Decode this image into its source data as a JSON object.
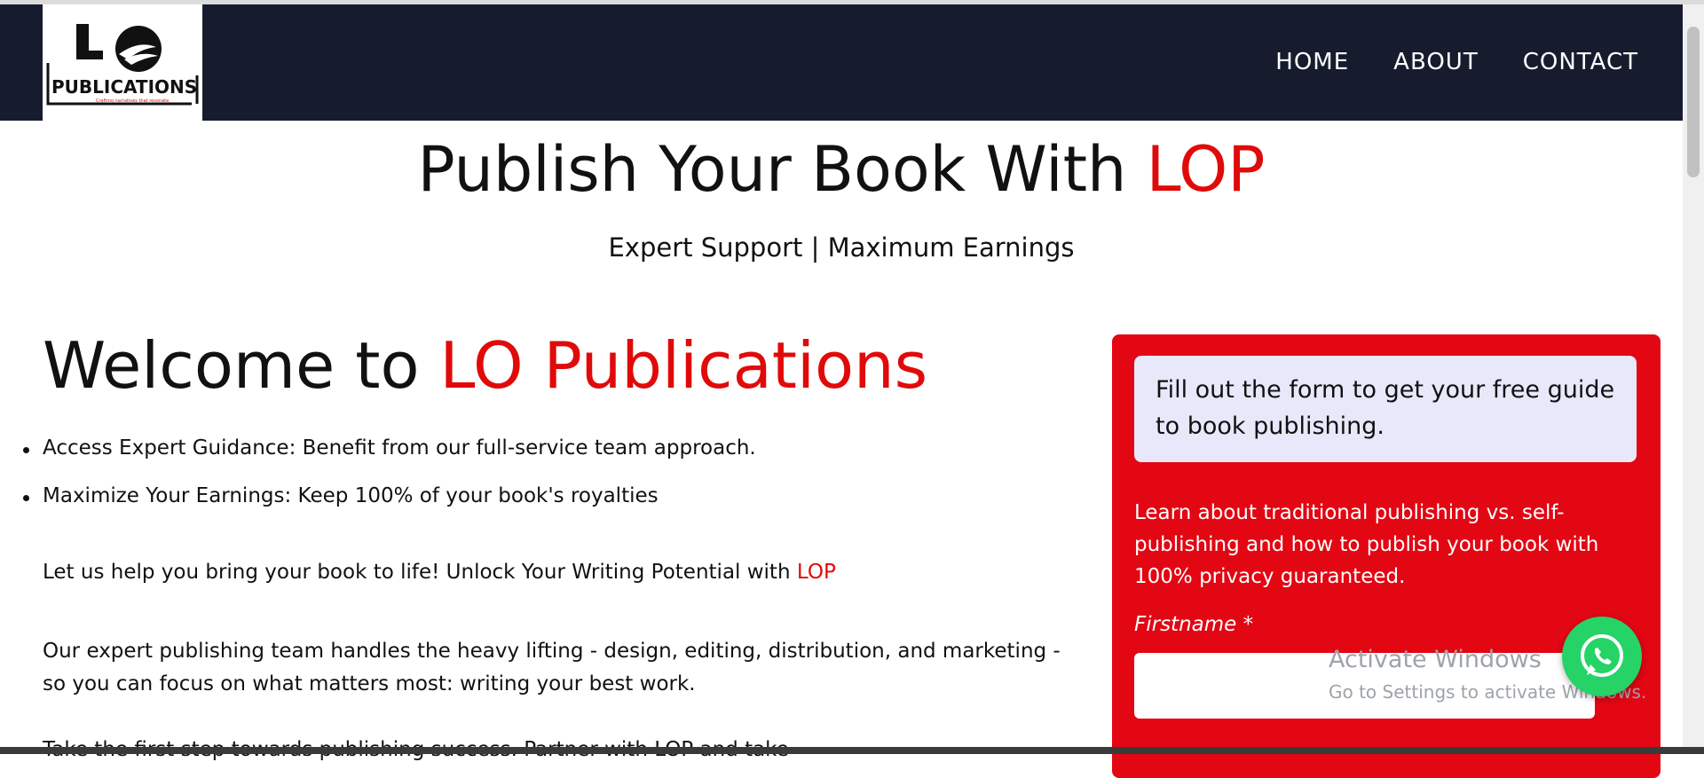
{
  "brand": {
    "logo_text": "PUBLICATIONS",
    "logo_tagline": "Crafting narratives that resonate",
    "logo_initials": "LO"
  },
  "nav": {
    "items": [
      {
        "label": "HOME"
      },
      {
        "label": "ABOUT"
      },
      {
        "label": "CONTACT"
      }
    ]
  },
  "hero": {
    "title_prefix": "Publish Your Book With ",
    "title_accent": "LOP",
    "subtitle": "Expert Support | Maximum Earnings"
  },
  "welcome": {
    "prefix": "Welcome to ",
    "accent": "LO Publications"
  },
  "bullets": [
    "Access Expert Guidance: Benefit from our full-service team approach.",
    "Maximize Your Earnings: Keep 100% of your book's royalties"
  ],
  "paragraph1": {
    "text": "Let us help you bring your book to life! Unlock Your Writing Potential with ",
    "accent": "LOP"
  },
  "paragraph2": "Our expert publishing team handles the heavy lifting - design, editing, distribution, and marketing - so you can focus on what matters most: writing your best work.",
  "paragraph3": "Take the first step towards publishing success. Partner with LOP and take",
  "form": {
    "intro": "Fill out the form to get your free guide to book publishing.",
    "description": "Learn about traditional publishing vs. self-publishing and how to publish your book with 100% privacy guaranteed.",
    "firstname_label": "Firstname",
    "required_mark": "*",
    "firstname_value": ""
  },
  "watermark": {
    "line1": "Activate Windows",
    "line2": "Go to Settings to activate Windows."
  },
  "colors": {
    "header_bg": "#161c2e",
    "accent_red": "#e10a0a",
    "panel_red": "#e30613",
    "intro_box": "#e8e8fb",
    "whatsapp_green": "#25d366"
  }
}
